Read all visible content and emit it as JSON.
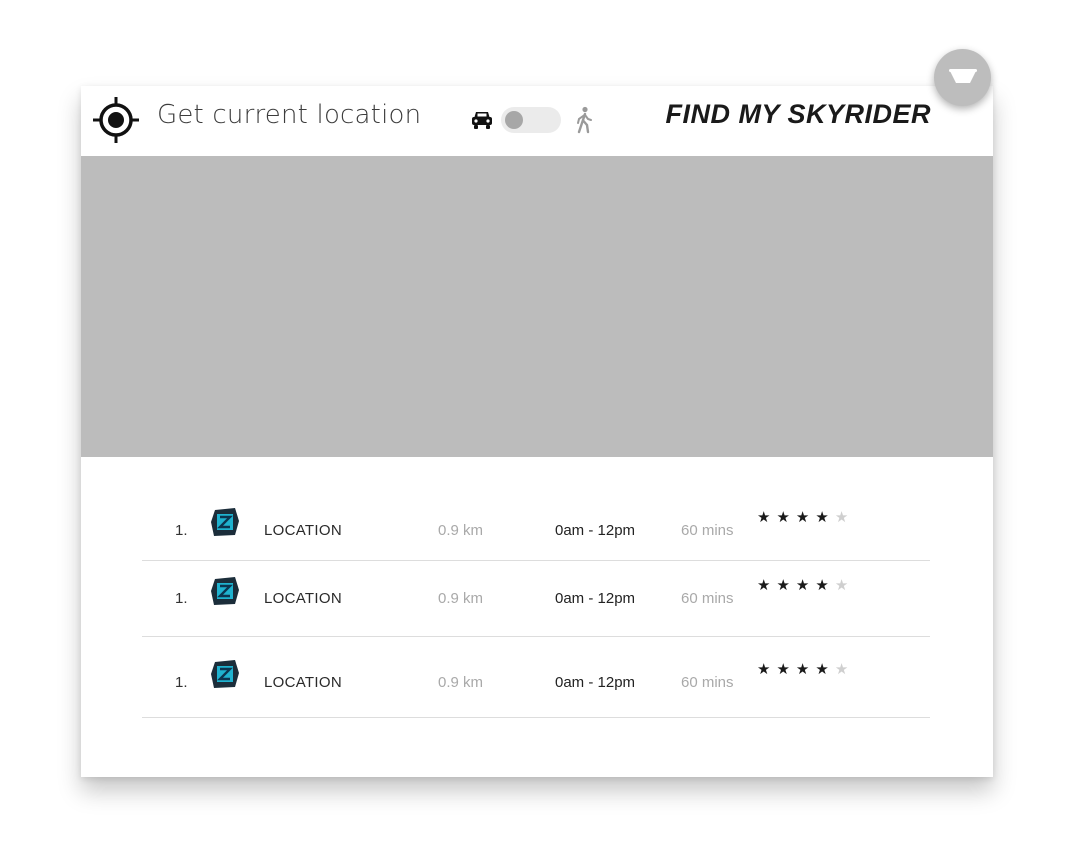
{
  "header": {
    "locate_icon": "crosshair-icon",
    "locate_label": "Get current location",
    "mode": {
      "left_icon": "car-icon",
      "right_icon": "walk-icon",
      "toggle_state": "car"
    },
    "brand": "FIND MY SKYRIDER"
  },
  "fab": {
    "icon": "cup-icon"
  },
  "map": {
    "color": "#bcbcbc"
  },
  "list": {
    "rows": [
      {
        "index": "1.",
        "logo_icon": "z-logo-icon",
        "name": "LOCATION",
        "distance": "0.9 km",
        "hours": "0am - 12pm",
        "duration": "60 mins",
        "rating": 4,
        "max_rating": 5
      },
      {
        "index": "1.",
        "logo_icon": "z-logo-icon",
        "name": "LOCATION",
        "distance": "0.9 km",
        "hours": "0am - 12pm",
        "duration": "60 mins",
        "rating": 4,
        "max_rating": 5
      },
      {
        "index": "1.",
        "logo_icon": "z-logo-icon",
        "name": "LOCATION",
        "distance": "0.9 km",
        "hours": "0am - 12pm",
        "duration": "60 mins",
        "rating": 4,
        "max_rating": 5
      }
    ]
  }
}
